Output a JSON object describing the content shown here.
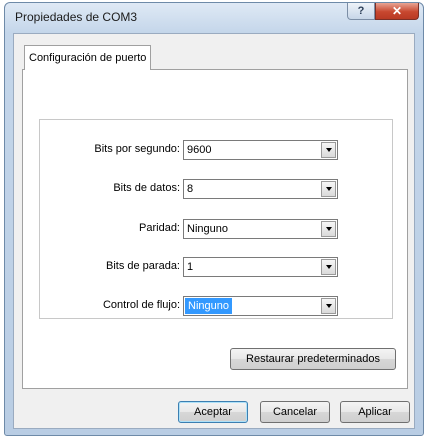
{
  "window": {
    "title": "Propiedades de COM3",
    "help_label": "?",
    "close_label": "✕"
  },
  "tabs": [
    {
      "label": "Configuración de puerto"
    }
  ],
  "settings": [
    {
      "label": "Bits por segundo:",
      "value": "9600"
    },
    {
      "label": "Bits de datos:",
      "value": "8"
    },
    {
      "label": "Paridad:",
      "value": "Ninguno"
    },
    {
      "label": "Bits de parada:",
      "value": "1"
    },
    {
      "label": "Control de flujo:",
      "value": "Ninguno"
    }
  ],
  "buttons": {
    "restore": "Restaurar predeterminados",
    "accept": "Aceptar",
    "cancel": "Cancelar",
    "apply": "Aplicar"
  },
  "colors": {
    "selection": "#3399ff",
    "close": "#c8472f"
  }
}
